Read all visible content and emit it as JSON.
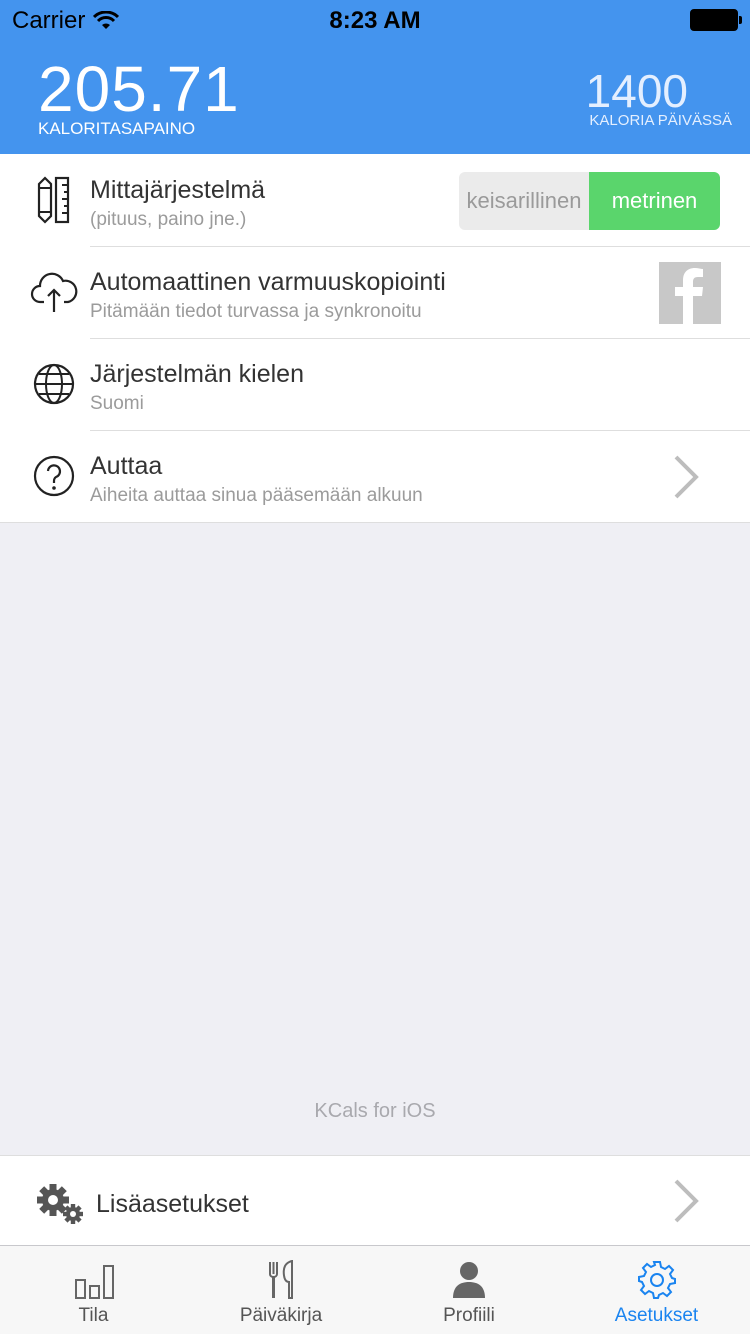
{
  "status": {
    "carrier": "Carrier",
    "time": "8:23 AM"
  },
  "header": {
    "balance_value": "205.71",
    "balance_label": "KALORITASAPAINO",
    "daily_value": "1400",
    "daily_label": "KALORIA PÄIVÄSSÄ"
  },
  "settings": [
    {
      "title": "Mittajärjestelmä",
      "subtitle": "(pituus, paino jne.)",
      "icon": "ruler-pencil-icon"
    },
    {
      "title": "Automaattinen varmuuskopiointi",
      "subtitle": "Pitämään tiedot turvassa ja synkronoitu",
      "icon": "cloud-upload-icon"
    },
    {
      "title": "Järjestelmän kielen",
      "subtitle": "Suomi",
      "icon": "globe-icon"
    },
    {
      "title": "Auttaa",
      "subtitle": "Aiheita auttaa sinua pääsemään alkuun",
      "icon": "help-icon"
    }
  ],
  "unit_toggle": {
    "option_imperial": "keisarillinen",
    "option_metric": "metrinen",
    "selected": "metrinen"
  },
  "footer_text": "KCals for iOS",
  "more_settings": {
    "label": "Lisäasetukset",
    "icon": "gears-icon"
  },
  "tabs": [
    {
      "label": "Tila",
      "icon": "bar-chart-icon",
      "active": false
    },
    {
      "label": "Päiväkirja",
      "icon": "fork-knife-icon",
      "active": false
    },
    {
      "label": "Profiili",
      "icon": "person-icon",
      "active": false
    },
    {
      "label": "Asetukset",
      "icon": "gear-icon",
      "active": true
    }
  ],
  "colors": {
    "header_bg": "#4494ee",
    "toggle_active": "#5ad56c",
    "tab_active": "#1a84f0"
  }
}
